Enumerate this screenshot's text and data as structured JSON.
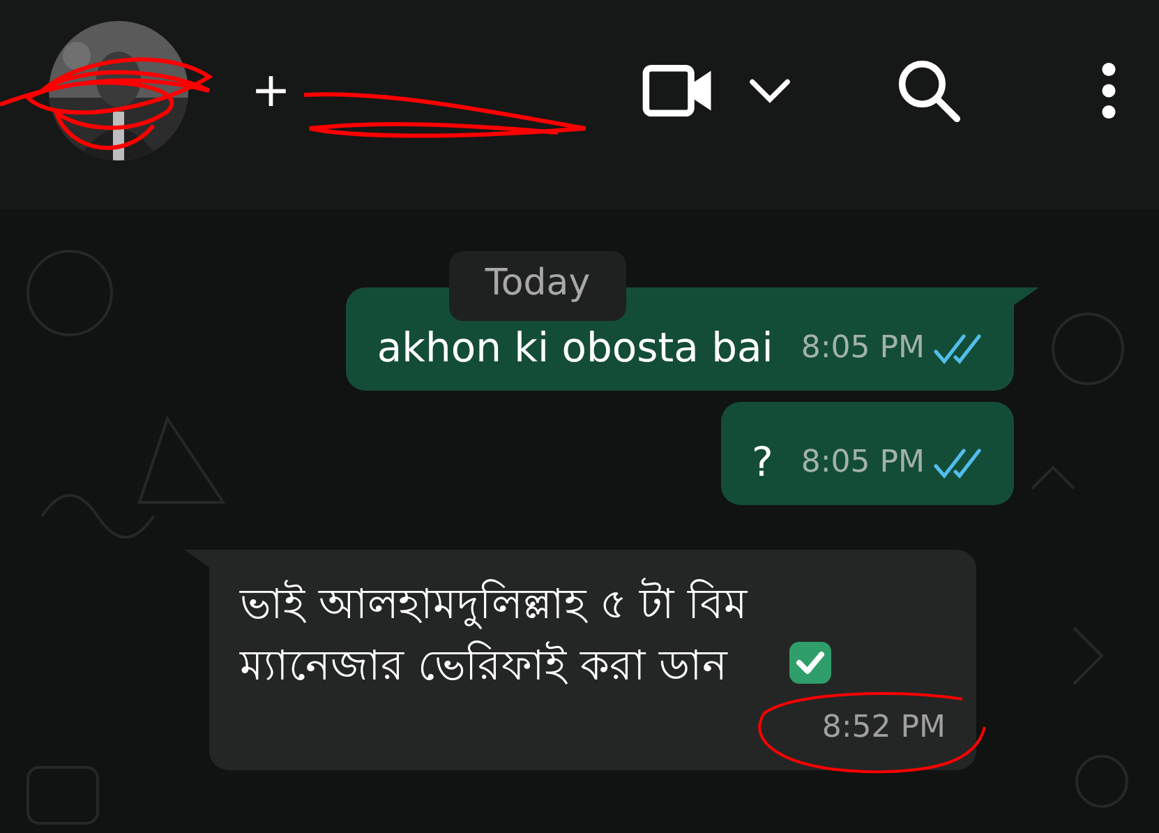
{
  "header": {
    "title": "+"
  },
  "date_chip": "Today",
  "messages": [
    {
      "kind": "outgoing",
      "text": "akhon ki obosta bai",
      "time": "8:05 PM",
      "read": true,
      "tail": true
    },
    {
      "kind": "outgoing",
      "text": "?",
      "time": "8:05 PM",
      "read": true,
      "tail": false
    },
    {
      "kind": "incoming",
      "text": "ভাই আলহামদুলিল্লাহ ৫ টা বিম ম্যানেজার ভেরিফাই করা ডান",
      "time": "8:52 PM",
      "tail": true,
      "check_emoji": true
    }
  ]
}
